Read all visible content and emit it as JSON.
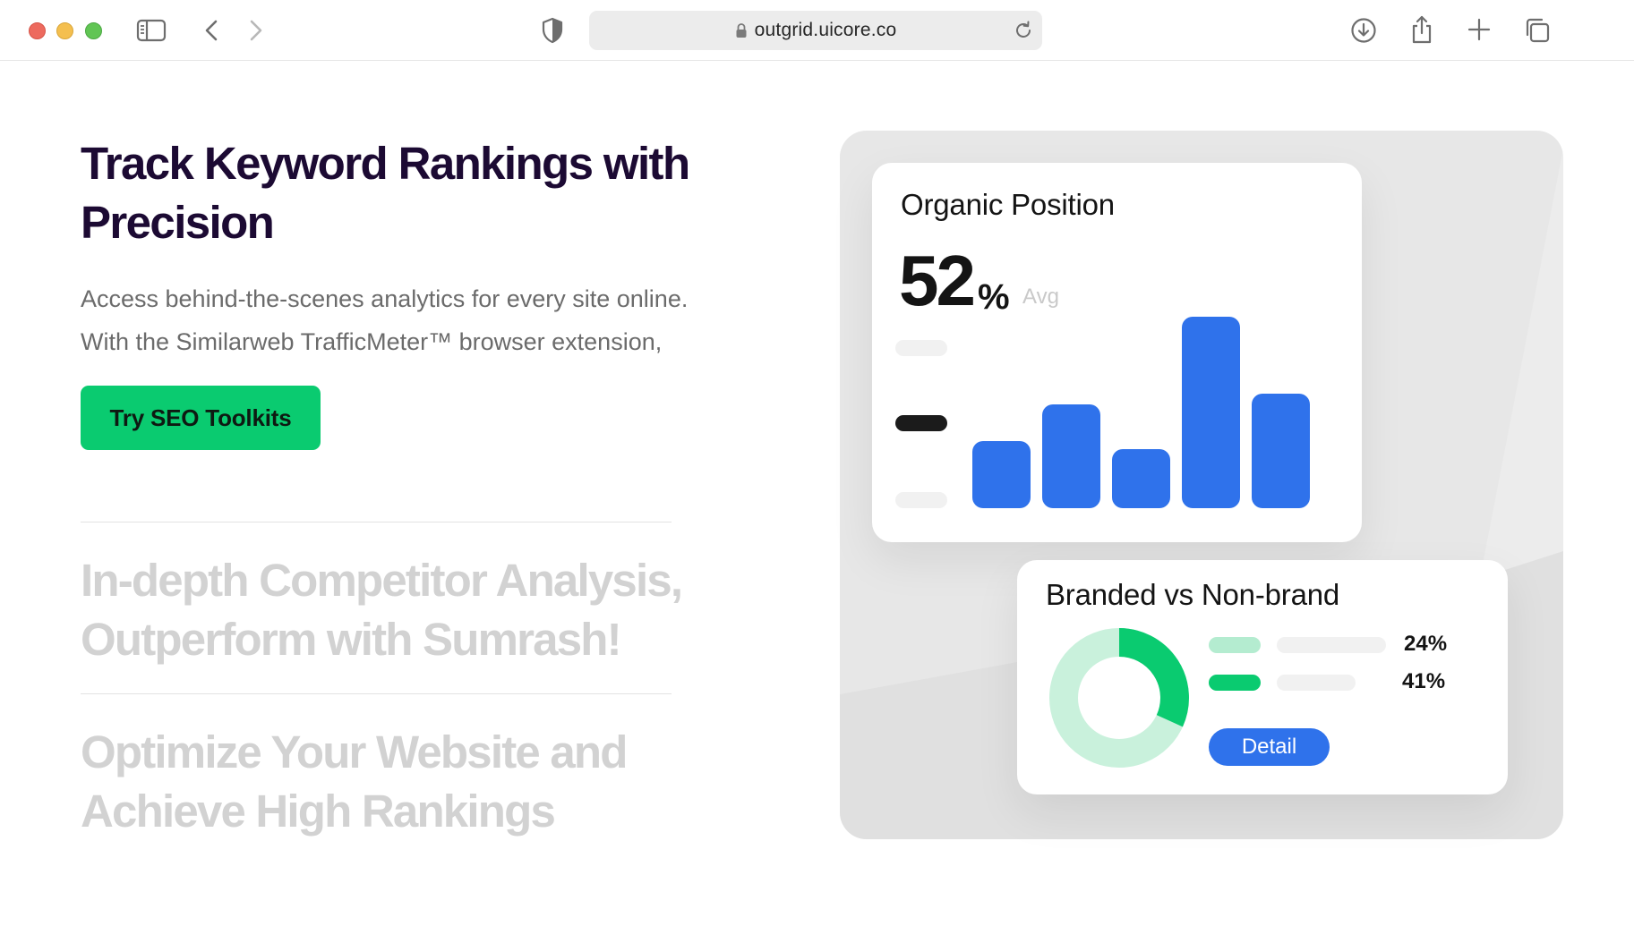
{
  "browser": {
    "url": "outgrid.uicore.co"
  },
  "hero": {
    "title": "Track Keyword Rankings with Precision",
    "description": "Access behind-the-scenes analytics for every site online. With the Similarweb TrafficMeter™ browser extension,",
    "cta_label": "Try SEO Toolkits"
  },
  "features": [
    {
      "title": "In-depth Competitor Analysis, Outperform with Sumrash!"
    },
    {
      "title": "Optimize Your Website and Achieve High Rankings"
    }
  ],
  "organic_card": {
    "title": "Organic Position",
    "value": "52",
    "unit": "%",
    "avg_label": "Avg",
    "bar_levels": [
      0.35,
      0.54,
      0.31,
      1.0,
      0.6
    ]
  },
  "brand_card": {
    "title": "Branded vs Non-brand",
    "legend": [
      {
        "pct": "24%",
        "color": "#b4ecd0"
      },
      {
        "pct": "41%",
        "color": "#0acb70"
      }
    ],
    "detail_label": "Detail"
  },
  "colors": {
    "accent_green": "#0acb70",
    "accent_blue": "#2f72eb",
    "title_dark": "#1c0a33"
  }
}
